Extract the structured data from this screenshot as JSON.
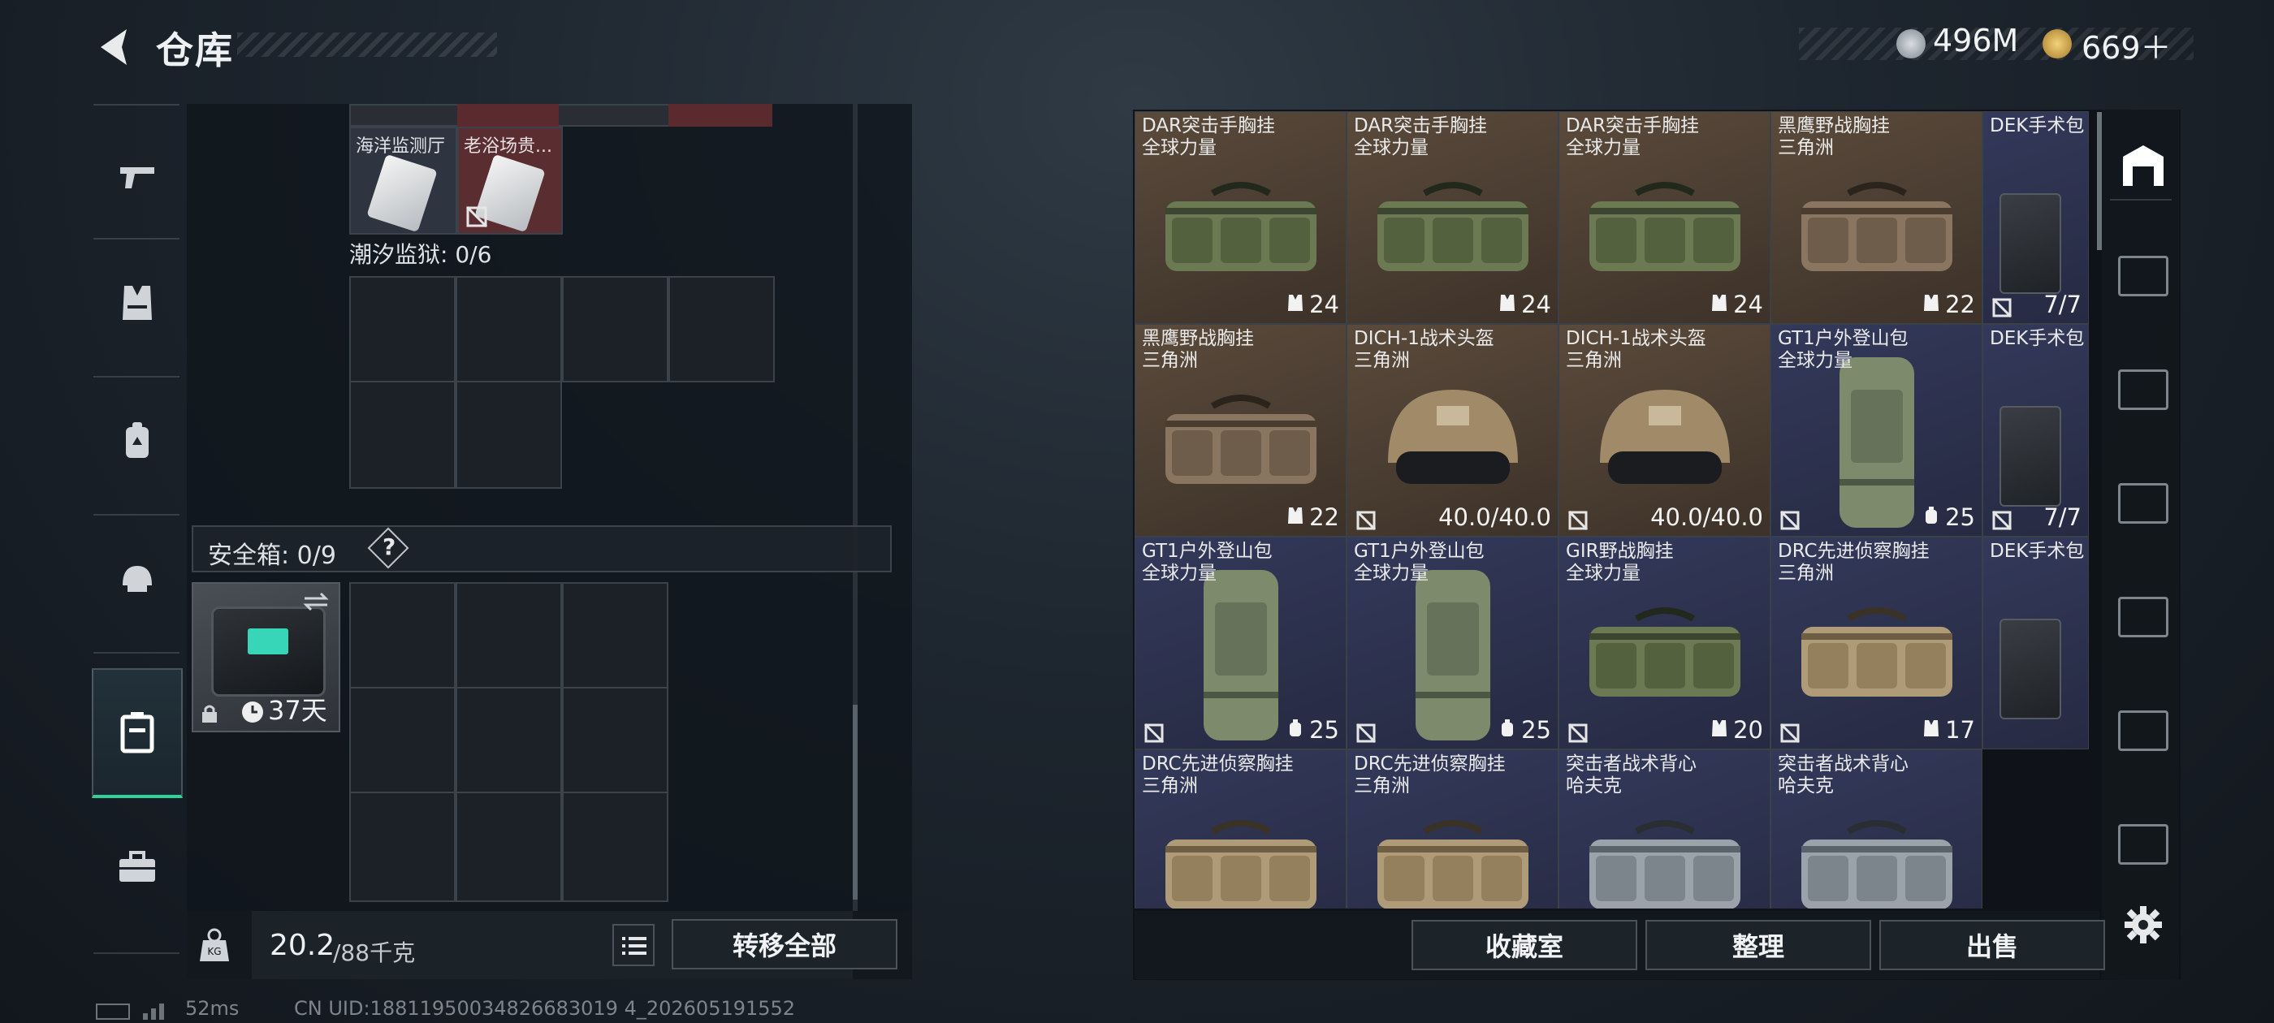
{
  "header": {
    "title": "仓库",
    "currency_silver": "496M",
    "currency_gold": "669＋"
  },
  "left_nav": {
    "items": [
      "weapon",
      "vest",
      "backpack",
      "helmet",
      "container",
      "briefcase"
    ],
    "active_index": 4
  },
  "storage": {
    "top_items": [
      {
        "name": "海洋监测厅"
      },
      {
        "name": "老浴场贵..."
      }
    ],
    "section_label": "潮汐监狱: 0/6",
    "safe_label": "安全箱: 0/9",
    "safe_help": "?",
    "safe_box_time": "37天",
    "weight_value": "20.2",
    "weight_max": "/88千克",
    "transfer_all": "转移全部"
  },
  "inventory": {
    "items": [
      {
        "l1": "DAR突击手胸挂",
        "l2": "全球力量",
        "count": "24",
        "icon": "vest",
        "bg": "brown",
        "art": "bag-green",
        "lock": false
      },
      {
        "l1": "DAR突击手胸挂",
        "l2": "全球力量",
        "count": "24",
        "icon": "vest",
        "bg": "brown",
        "art": "bag-green",
        "lock": false
      },
      {
        "l1": "DAR突击手胸挂",
        "l2": "全球力量",
        "count": "24",
        "icon": "vest",
        "bg": "brown",
        "art": "bag-green",
        "lock": false
      },
      {
        "l1": "黑鹰野战胸挂",
        "l2": "三角洲",
        "count": "22",
        "icon": "vest",
        "bg": "brown",
        "art": "bag-camo",
        "lock": false
      },
      {
        "l1": "黑鹰野战胸挂",
        "l2": "三角洲",
        "count": "22",
        "icon": "vest",
        "bg": "brown",
        "art": "bag-camo",
        "lock": false
      },
      {
        "l1": "DICH-1战术头盔",
        "l2": "三角洲",
        "count": "40.0/40.0",
        "icon": "",
        "bg": "brown",
        "art": "helmet",
        "lock": true
      },
      {
        "l1": "DICH-1战术头盔",
        "l2": "三角洲",
        "count": "40.0/40.0",
        "icon": "",
        "bg": "brown",
        "art": "helmet",
        "lock": true
      },
      {
        "l1": "GT1户外登山包",
        "l2": "全球力量",
        "count": "25",
        "icon": "pack",
        "bg": "blue",
        "art": "tall-pack",
        "lock": true
      },
      {
        "l1": "GT1户外登山包",
        "l2": "全球力量",
        "count": "25",
        "icon": "pack",
        "bg": "blue",
        "art": "tall-pack",
        "lock": true
      },
      {
        "l1": "GT1户外登山包",
        "l2": "全球力量",
        "count": "25",
        "icon": "pack",
        "bg": "blue",
        "art": "tall-pack",
        "lock": true
      },
      {
        "l1": "GIR野战胸挂",
        "l2": "全球力量",
        "count": "20",
        "icon": "vest",
        "bg": "blue",
        "art": "bag-green",
        "lock": true
      },
      {
        "l1": "DRC先进侦察胸挂",
        "l2": "三角洲",
        "count": "17",
        "icon": "vest",
        "bg": "blue",
        "art": "bag-tan",
        "lock": true
      },
      {
        "l1": "DRC先进侦察胸挂",
        "l2": "三角洲",
        "count": "",
        "icon": "",
        "bg": "blue",
        "art": "bag-tan",
        "lock": false
      },
      {
        "l1": "DRC先进侦察胸挂",
        "l2": "三角洲",
        "count": "",
        "icon": "",
        "bg": "blue",
        "art": "bag-tan",
        "lock": false
      },
      {
        "l1": "突击者战术背心",
        "l2": "哈夫克",
        "count": "",
        "icon": "",
        "bg": "blue",
        "art": "bag-grey",
        "lock": false
      },
      {
        "l1": "突击者战术背心",
        "l2": "哈夫克",
        "count": "",
        "icon": "",
        "bg": "blue",
        "art": "bag-grey",
        "lock": false
      }
    ],
    "dek": [
      {
        "name": "DEK手术包",
        "count": "7/7"
      },
      {
        "name": "DEK手术包",
        "count": "7/7"
      },
      {
        "name": "DEK手术包",
        "count": ""
      }
    ],
    "buttons": {
      "collection": "收藏室",
      "organize": "整理",
      "sell": "出售"
    }
  },
  "footer": {
    "ping": "52ms",
    "uid": "CN UID:18811950034826683019 4_202605191552"
  }
}
